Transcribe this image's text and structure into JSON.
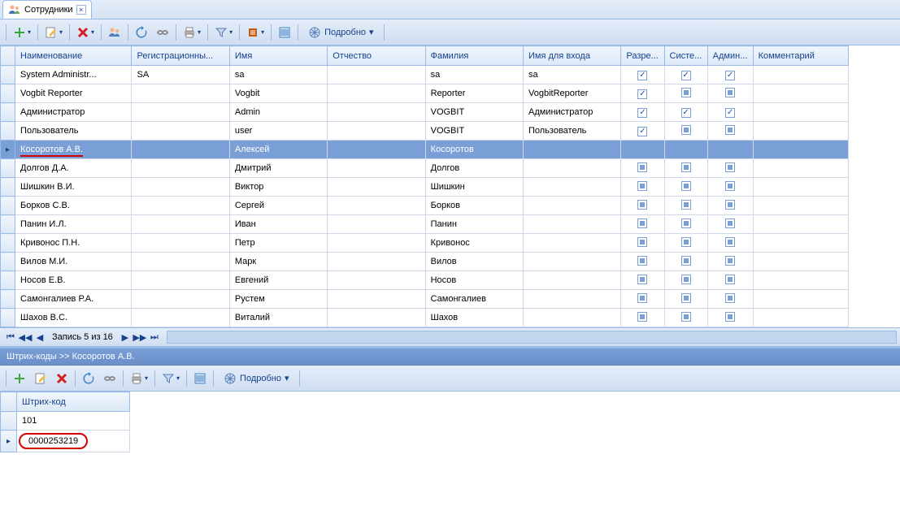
{
  "tab": {
    "label": "Сотрудники"
  },
  "toolbar_top": {
    "details": "Подробно"
  },
  "columns": {
    "name": "Наименование",
    "regnum": "Регистрационны...",
    "first": "Имя",
    "middle": "Отчество",
    "last": "Фамилия",
    "login": "Имя для входа",
    "perm": "Разре...",
    "sys": "Систе...",
    "admin": "Админ...",
    "comment": "Комментарий"
  },
  "rows": [
    {
      "name": "System Administr...",
      "reg": "SA",
      "first": "sa",
      "mid": "",
      "last": "sa",
      "login": "sa",
      "perm": "c",
      "sys": "c",
      "admin": "c"
    },
    {
      "name": "Vogbit Reporter",
      "reg": "",
      "first": "Vogbit",
      "mid": "",
      "last": "Reporter",
      "login": "VogbitReporter",
      "perm": "c",
      "sys": "p",
      "admin": "p"
    },
    {
      "name": "Администратор",
      "reg": "",
      "first": "Admin",
      "mid": "",
      "last": "VOGBIT",
      "login": "Администратор",
      "perm": "c",
      "sys": "c",
      "admin": "c"
    },
    {
      "name": "Пользователь",
      "reg": "",
      "first": "user",
      "mid": "",
      "last": "VOGBIT",
      "login": "Пользователь",
      "perm": "c",
      "sys": "p",
      "admin": "p"
    },
    {
      "name": "Косоротов А.В.",
      "reg": "",
      "first": "Алексей",
      "mid": "",
      "last": "Косоротов",
      "login": "",
      "perm": "p",
      "sys": "p",
      "admin": "p",
      "selected": true,
      "underline": true
    },
    {
      "name": "Долгов Д.А.",
      "reg": "",
      "first": "Дмитрий",
      "mid": "",
      "last": "Долгов",
      "login": "",
      "perm": "p",
      "sys": "p",
      "admin": "p"
    },
    {
      "name": "Шишкин В.И.",
      "reg": "",
      "first": "Виктор",
      "mid": "",
      "last": "Шишкин",
      "login": "",
      "perm": "p",
      "sys": "p",
      "admin": "p"
    },
    {
      "name": "Борков С.В.",
      "reg": "",
      "first": "Сергей",
      "mid": "",
      "last": "Борков",
      "login": "",
      "perm": "p",
      "sys": "p",
      "admin": "p"
    },
    {
      "name": "Панин И.Л.",
      "reg": "",
      "first": "Иван",
      "mid": "",
      "last": "Панин",
      "login": "",
      "perm": "p",
      "sys": "p",
      "admin": "p"
    },
    {
      "name": "Кривонос П.Н.",
      "reg": "",
      "first": "Петр",
      "mid": "",
      "last": "Кривонос",
      "login": "",
      "perm": "p",
      "sys": "p",
      "admin": "p"
    },
    {
      "name": "Вилов М.И.",
      "reg": "",
      "first": "Марк",
      "mid": "",
      "last": "Вилов",
      "login": "",
      "perm": "p",
      "sys": "p",
      "admin": "p"
    },
    {
      "name": "Носов Е.В.",
      "reg": "",
      "first": "Евгений",
      "mid": "",
      "last": "Носов",
      "login": "",
      "perm": "p",
      "sys": "p",
      "admin": "p"
    },
    {
      "name": "Самонгалиев Р.А.",
      "reg": "",
      "first": "Рустем",
      "mid": "",
      "last": "Самонгалиев",
      "login": "",
      "perm": "p",
      "sys": "p",
      "admin": "p"
    },
    {
      "name": "Шахов В.С.",
      "reg": "",
      "first": "Виталий",
      "mid": "",
      "last": "Шахов",
      "login": "",
      "perm": "p",
      "sys": "p",
      "admin": "p"
    }
  ],
  "nav": {
    "status": "Запись 5 из 16"
  },
  "detail_panel": {
    "header": "Штрих-коды >> Косоротов А.В.",
    "col": "Штрих-код",
    "rows": [
      "101",
      "0000253219"
    ]
  },
  "toolbar_bottom": {
    "details": "Подробно"
  }
}
